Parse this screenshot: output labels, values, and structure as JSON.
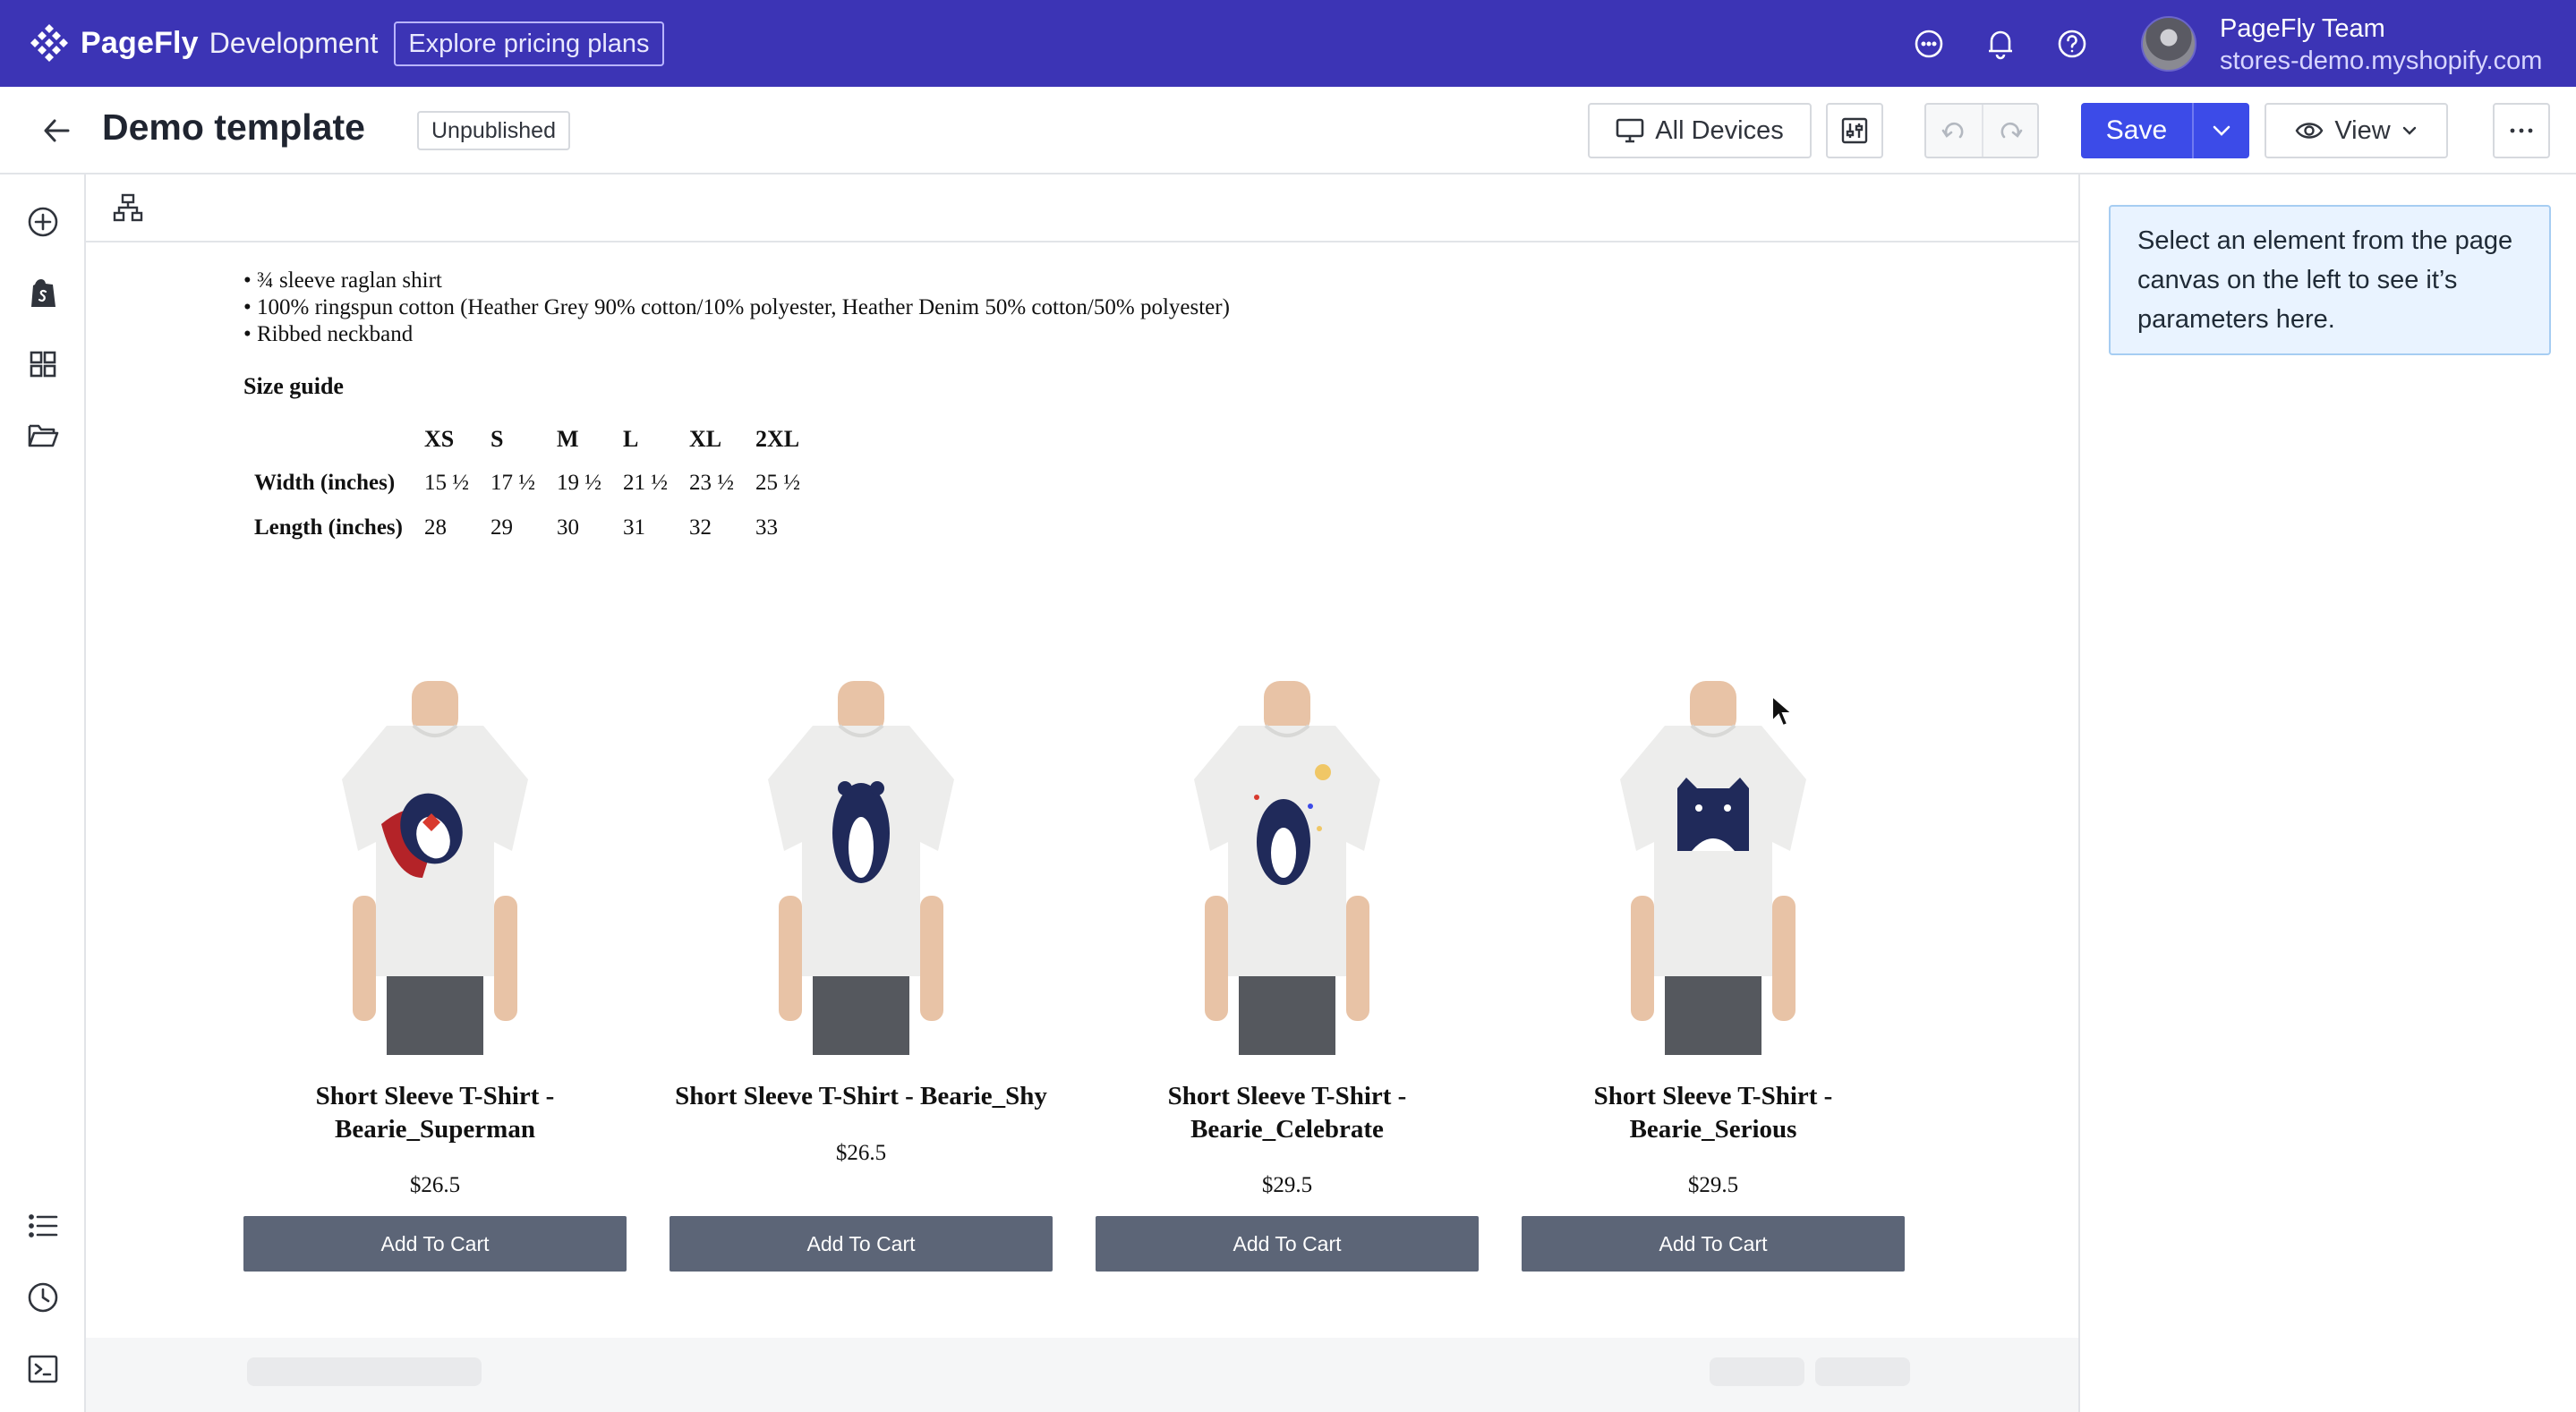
{
  "topbar": {
    "brand_name": "PageFly",
    "brand_env": "Development",
    "pricing_button": "Explore pricing plans",
    "icons": [
      "chat-icon",
      "bell-icon",
      "help-icon"
    ],
    "account_name": "PageFly Team",
    "account_store": "stores-demo.myshopify.com",
    "color": "#3c34b5"
  },
  "header": {
    "title": "Demo template",
    "status": "Unpublished",
    "devices_label": "All Devices",
    "save_label": "Save",
    "view_label": "View",
    "save_color": "#3c4be8"
  },
  "sidebar": {
    "top_icons": [
      "add-element-icon",
      "shopify-icon",
      "grid-icon",
      "folder-icon"
    ],
    "bottom_icons": [
      "list-icon",
      "history-icon",
      "console-icon"
    ]
  },
  "canvas": {
    "bullets": [
      "• ¾ sleeve raglan shirt",
      "• 100% ringspun cotton (Heather Grey 90% cotton/10% polyester, Heather Denim 50% cotton/50% polyester)",
      "• Ribbed neckband"
    ],
    "size_guide_title": "Size guide",
    "size_table": {
      "headers": [
        "",
        "XS",
        "S",
        "M",
        "L",
        "XL",
        "2XL"
      ],
      "rows": [
        [
          "Width (inches)",
          "15 ½",
          "17 ½",
          "19 ½",
          "21 ½",
          "23 ½",
          "25 ½"
        ],
        [
          "Length (inches)",
          "28",
          "29",
          "30",
          "31",
          "32",
          "33"
        ]
      ]
    },
    "products": [
      {
        "title": "Short Sleeve T-Shirt - Bearie_Superman",
        "price": "$26.5",
        "button": "Add To Cart"
      },
      {
        "title": "Short Sleeve T-Shirt - Bearie_Shy",
        "price": "$26.5",
        "button": "Add To Cart"
      },
      {
        "title": "Short Sleeve T-Shirt - Bearie_Celebrate",
        "price": "$29.5",
        "button": "Add To Cart"
      },
      {
        "title": "Short Sleeve T-Shirt - Bearie_Serious",
        "price": "$29.5",
        "button": "Add To Cart"
      }
    ]
  },
  "right_panel": {
    "message": "Select an element from the page canvas on the left to see it’s parameters here."
  }
}
